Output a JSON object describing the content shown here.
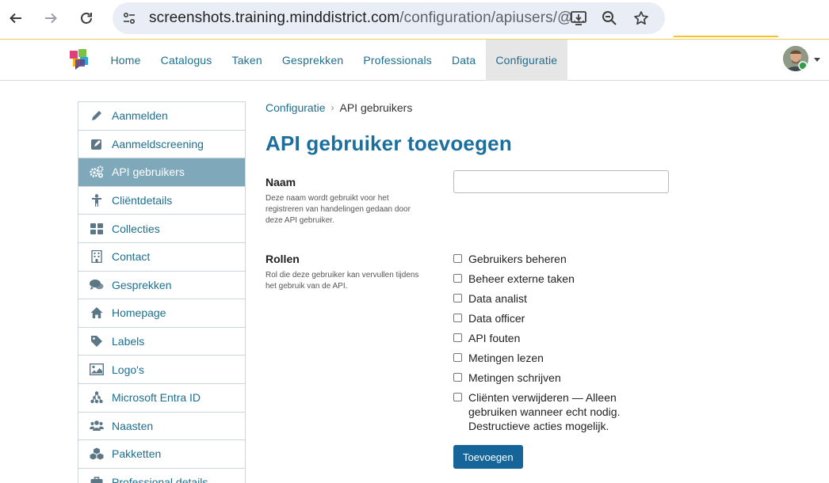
{
  "browser": {
    "url_main": "screenshots.training.minddistrict.com",
    "url_rest": "/configuration/apiusers/@..."
  },
  "topnav": {
    "items": [
      {
        "label": "Home"
      },
      {
        "label": "Catalogus"
      },
      {
        "label": "Taken"
      },
      {
        "label": "Gesprekken"
      },
      {
        "label": "Professionals"
      },
      {
        "label": "Data"
      },
      {
        "label": "Configuratie",
        "active": true
      }
    ]
  },
  "sidebar": {
    "items": [
      {
        "label": "Aanmelden",
        "icon": "pencil-icon"
      },
      {
        "label": "Aanmeldscreening",
        "icon": "edit-icon"
      },
      {
        "label": "API gebruikers",
        "icon": "cogs-icon",
        "active": true
      },
      {
        "label": "Cliëntdetails",
        "icon": "person-icon"
      },
      {
        "label": "Collecties",
        "icon": "grid-icon"
      },
      {
        "label": "Contact",
        "icon": "building-icon"
      },
      {
        "label": "Gesprekken",
        "icon": "chat-icon"
      },
      {
        "label": "Homepage",
        "icon": "home-icon"
      },
      {
        "label": "Labels",
        "icon": "tag-icon"
      },
      {
        "label": "Logo's",
        "icon": "image-icon"
      },
      {
        "label": "Microsoft Entra ID",
        "icon": "sitemap-icon"
      },
      {
        "label": "Naasten",
        "icon": "users-icon"
      },
      {
        "label": "Pakketten",
        "icon": "cubes-icon"
      },
      {
        "label": "Professional details",
        "icon": "briefcase-icon"
      }
    ]
  },
  "breadcrumb": {
    "parent": "Configuratie",
    "current": "API gebruikers"
  },
  "page": {
    "title": "API gebruiker toevoegen"
  },
  "form": {
    "name": {
      "label": "Naam",
      "help": "Deze naam wordt gebruikt voor het registreren van handelingen gedaan door deze API gebruiker.",
      "value": ""
    },
    "roles": {
      "label": "Rollen",
      "help": "Rol die deze gebruiker kan vervullen tijdens het gebruik van de API.",
      "options": [
        {
          "label": "Gebruikers beheren",
          "checked": false
        },
        {
          "label": "Beheer externe taken",
          "checked": false
        },
        {
          "label": "Data analist",
          "checked": false
        },
        {
          "label": "Data officer",
          "checked": false
        },
        {
          "label": "API fouten",
          "checked": false
        },
        {
          "label": "Metingen lezen",
          "checked": false
        },
        {
          "label": "Metingen schrijven",
          "checked": false
        },
        {
          "label": "Cliënten verwijderen — Alleen gebruiken wanneer echt nodig. Destructieve acties mogelijk.",
          "checked": false
        }
      ]
    },
    "submit_label": "Toevoegen"
  },
  "colors": {
    "link": "#1c6e8f",
    "title": "#1a6f9e",
    "sidebar_active": "#7fa9bb",
    "button": "#16659a"
  }
}
